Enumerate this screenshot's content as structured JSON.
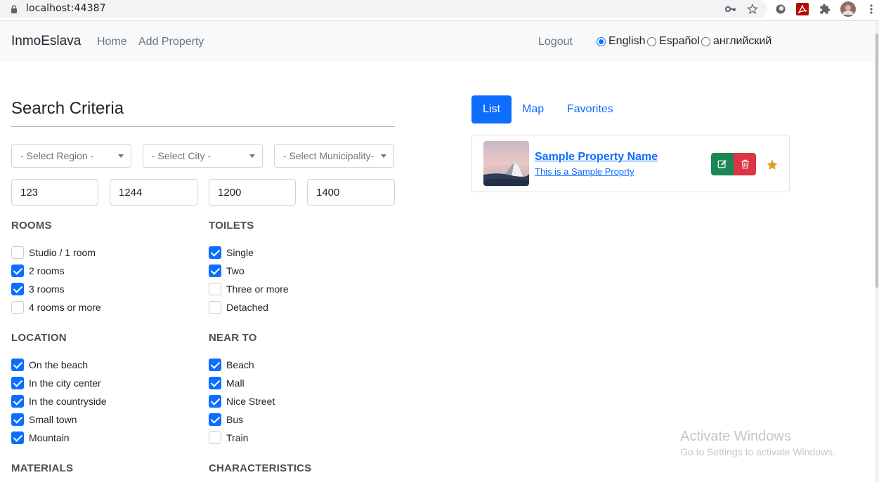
{
  "browser": {
    "url": "localhost:44387",
    "icons": [
      "lock-icon",
      "key-icon",
      "star-bookmark-icon",
      "extension-circle-icon",
      "pdf-extension-icon",
      "puzzle-icon",
      "profile-avatar",
      "more-vert-icon"
    ]
  },
  "navbar": {
    "brand": "InmoEslava",
    "links": [
      "Home",
      "Add Property"
    ],
    "logout": "Logout",
    "languages": [
      {
        "label": "English",
        "selected": true
      },
      {
        "label": "Español",
        "selected": false
      },
      {
        "label": "английский",
        "selected": false
      }
    ]
  },
  "search": {
    "title": "Search Criteria",
    "selects": [
      "- Select Region -",
      "- Select City -",
      "- Select Municipality-"
    ],
    "inputs": [
      "123",
      "1244",
      "1200",
      "1400"
    ],
    "rooms": {
      "heading": "ROOMS",
      "items": [
        {
          "label": "Studio / 1 room",
          "checked": false
        },
        {
          "label": "2 rooms",
          "checked": true
        },
        {
          "label": "3 rooms",
          "checked": true
        },
        {
          "label": "4 rooms or more",
          "checked": false
        }
      ]
    },
    "toilets": {
      "heading": "TOILETS",
      "items": [
        {
          "label": "Single",
          "checked": true
        },
        {
          "label": "Two",
          "checked": true
        },
        {
          "label": "Three or more",
          "checked": false
        },
        {
          "label": "Detached",
          "checked": false
        }
      ]
    },
    "location": {
      "heading": "LOCATION",
      "items": [
        {
          "label": "On the beach",
          "checked": true
        },
        {
          "label": "In the city center",
          "checked": true
        },
        {
          "label": "In the countryside",
          "checked": true
        },
        {
          "label": "Small town",
          "checked": true
        },
        {
          "label": "Mountain",
          "checked": true
        }
      ]
    },
    "near_to": {
      "heading": "NEAR TO",
      "items": [
        {
          "label": "Beach",
          "checked": true
        },
        {
          "label": "Mall",
          "checked": true
        },
        {
          "label": "Nice Street",
          "checked": true
        },
        {
          "label": "Bus",
          "checked": true
        },
        {
          "label": "Train",
          "checked": false
        }
      ]
    },
    "materials": {
      "heading": "MATERIALS"
    },
    "characteristics": {
      "heading": "CHARACTERISTICS"
    }
  },
  "results": {
    "tabs": [
      {
        "label": "List",
        "active": true
      },
      {
        "label": "Map",
        "active": false
      },
      {
        "label": "Favorites",
        "active": false
      }
    ],
    "property": {
      "name": "Sample Property Name",
      "description": "This is a Sample Proprty",
      "favorite": true
    }
  },
  "watermark": {
    "line1": "Activate Windows",
    "line2": "Go to Settings to activate Windows."
  },
  "colors": {
    "primary": "#0d6efd",
    "success": "#198754",
    "danger": "#dc3545",
    "star": "#e0a21a",
    "navbar_bg": "#f8f9fa"
  }
}
